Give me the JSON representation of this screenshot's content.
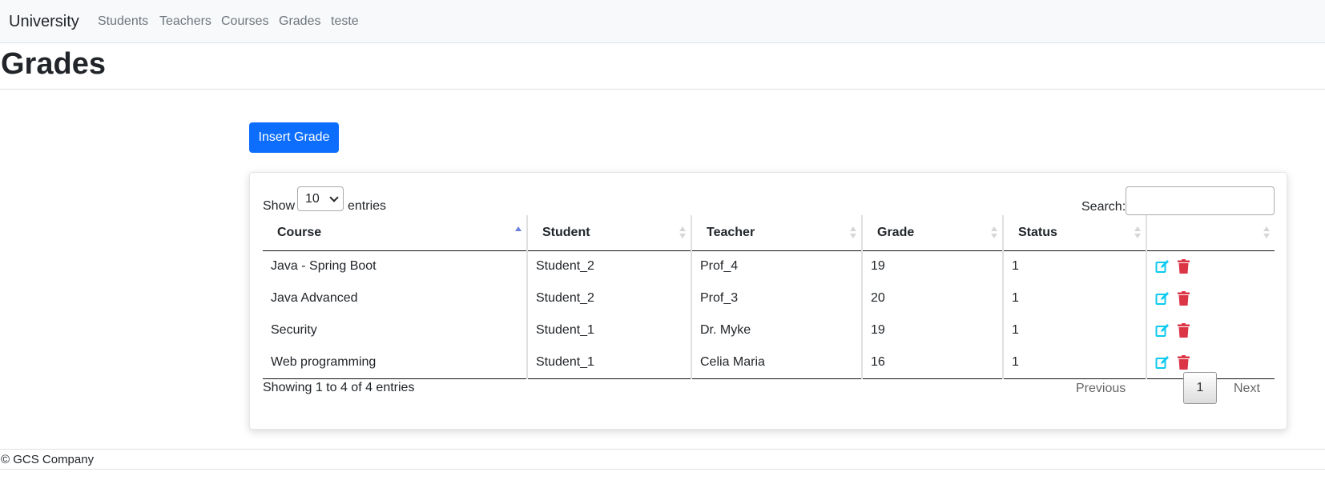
{
  "navbar": {
    "brand": "University",
    "links": [
      "Students",
      "Teachers",
      "Courses",
      "Grades",
      "teste"
    ]
  },
  "page": {
    "title": "Grades"
  },
  "actions": {
    "insert_label": "Insert Grade"
  },
  "table_controls": {
    "show_label": "Show",
    "entries_value": "10",
    "entries_label": "entries",
    "search_label": "Search:",
    "search_value": ""
  },
  "table": {
    "columns": [
      "Course",
      "Student",
      "Teacher",
      "Grade",
      "Status",
      ""
    ],
    "sorted_column": "Course",
    "sort_direction": "asc",
    "rows": [
      [
        "Java - Spring Boot",
        "Student_2",
        "Prof_4",
        "19",
        "1"
      ],
      [
        "Java Advanced",
        "Student_2",
        "Prof_3",
        "20",
        "1"
      ],
      [
        "Security",
        "Student_1",
        "Dr. Myke",
        "19",
        "1"
      ],
      [
        "Web programming",
        "Student_1",
        "Celia Maria",
        "16",
        "1"
      ]
    ],
    "row_actions": [
      "edit-icon",
      "trash-icon"
    ]
  },
  "pagination": {
    "info": "Showing 1 to 4 of 4 entries",
    "previous": "Previous",
    "current": "1",
    "next": "Next"
  },
  "footer": {
    "text": "© GCS Company"
  },
  "colors": {
    "primary": "#0d6efd",
    "edit_icon": "#0dcaf0",
    "delete_icon": "#dc3545",
    "navbar_bg": "#f8f9fa"
  }
}
